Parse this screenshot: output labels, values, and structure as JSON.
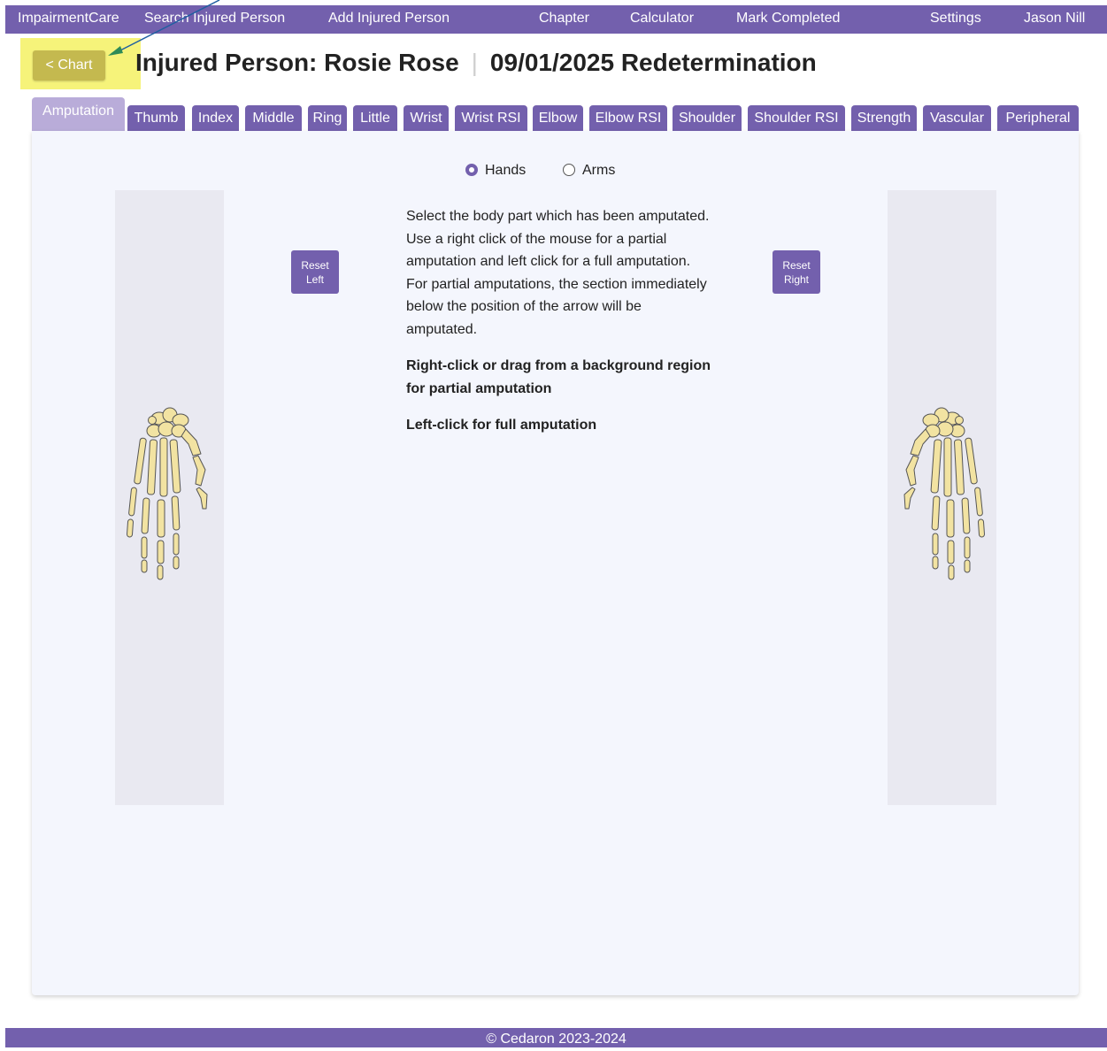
{
  "nav": {
    "brand": "ImpairmentCare",
    "search": "Search Injured Person",
    "add": "Add Injured Person",
    "chapter": "Chapter",
    "calculator": "Calculator",
    "mark_completed": "Mark Completed",
    "settings": "Settings",
    "user": "Jason Nill"
  },
  "header": {
    "back_button": "< Chart",
    "person": "Injured Person: Rosie Rose",
    "evaluation": "09/01/2025 Redetermination"
  },
  "tabs": [
    {
      "label": "Amputation",
      "active": true
    },
    {
      "label": "Thumb"
    },
    {
      "label": "Index"
    },
    {
      "label": "Middle"
    },
    {
      "label": "Ring"
    },
    {
      "label": "Little"
    },
    {
      "label": "Wrist"
    },
    {
      "label": "Wrist RSI"
    },
    {
      "label": "Elbow"
    },
    {
      "label": "Elbow RSI"
    },
    {
      "label": "Shoulder"
    },
    {
      "label": "Shoulder RSI"
    },
    {
      "label": "Strength"
    },
    {
      "label": "Vascular"
    },
    {
      "label": "Peripheral"
    }
  ],
  "body_selector": {
    "options": [
      {
        "label": "Hands",
        "selected": true
      },
      {
        "label": "Arms",
        "selected": false
      }
    ]
  },
  "reset_left": {
    "line1": "Reset",
    "line2": "Left"
  },
  "reset_right": {
    "line1": "Reset",
    "line2": "Right"
  },
  "instructions": {
    "text": "Select the body part which has been amputated. Use a right click of the mouse for a partial amputation and left click for a full amputation. For partial amputations, the section immediately below the position of the arrow will be amputated.",
    "partial": "Right-click or drag from a background region for partial amputation",
    "full": "Left-click for full amputation"
  },
  "footer": "© Cedaron 2023-2024",
  "colors": {
    "primary": "#7360ad",
    "active_tab": "#b9acd9",
    "highlight": "#f6f37a",
    "chart_button": "#c4b94f",
    "bone_fill": "#f2e3a2",
    "bone_stroke": "#555555",
    "panel": "#e9e9f1",
    "card": "#f4f6fd"
  }
}
